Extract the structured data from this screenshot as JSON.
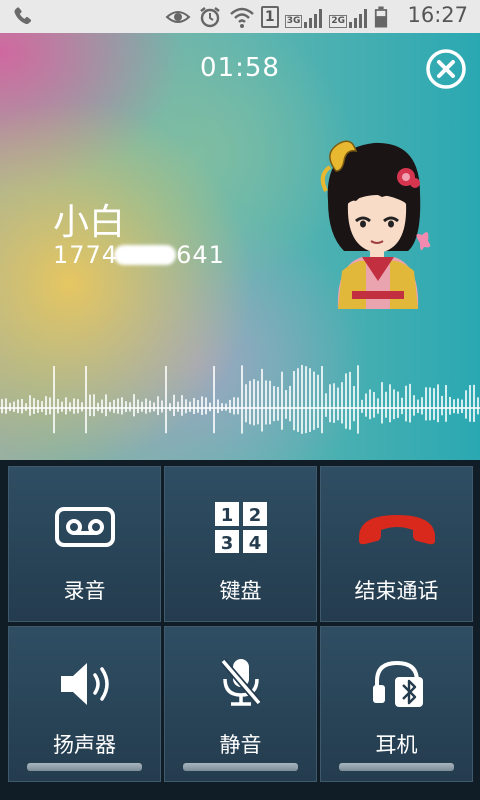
{
  "status_bar": {
    "time": "16:27",
    "sim_slot": "1",
    "network_primary": "3G",
    "network_secondary": "2G",
    "icons": [
      "phone-icon",
      "eye-icon",
      "alarm-icon",
      "wifi-icon",
      "sim-icon",
      "signal-3g-icon",
      "signal-2g-icon",
      "battery-icon"
    ]
  },
  "call": {
    "duration": "01:58",
    "caller_name": "小白",
    "number_prefix": "1774",
    "number_suffix": "641",
    "close_icon": "close-circle-icon"
  },
  "controls": [
    {
      "label": "录音",
      "icon": "cassette-record-icon"
    },
    {
      "label": "键盘",
      "icon": "keypad-icon",
      "keys": [
        "1",
        "2",
        "3",
        "4"
      ]
    },
    {
      "label": "结束通话",
      "icon": "end-call-icon"
    },
    {
      "label": "扬声器",
      "icon": "speaker-icon"
    },
    {
      "label": "静音",
      "icon": "mute-mic-icon"
    },
    {
      "label": "耳机",
      "icon": "bluetooth-headset-icon"
    }
  ],
  "colors": {
    "end_call": "#d9281c",
    "tile_bg": "#2a4558",
    "text": "#ffffff"
  }
}
